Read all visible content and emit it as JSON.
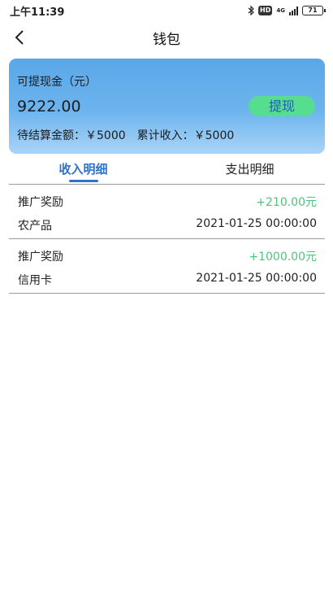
{
  "status_bar": {
    "time": "上午11:39",
    "hd": "HD",
    "network": "4G",
    "battery": "71"
  },
  "nav": {
    "title": "钱包"
  },
  "wallet": {
    "label": "可提现金（元）",
    "balance": "9222.00",
    "withdraw_label": "提现",
    "pending_label": "待结算金额：",
    "pending_value": "￥5000",
    "total_label": "累计收入：",
    "total_value": "￥5000"
  },
  "tabs": [
    {
      "label": "收入明细",
      "active": true
    },
    {
      "label": "支出明细",
      "active": false
    }
  ],
  "records": [
    {
      "type": "推广奖励",
      "amount": "+210.00元",
      "product": "农产品",
      "time": "2021-01-25 00:00:00"
    },
    {
      "type": "推广奖励",
      "amount": "+1000.00元",
      "product": "信用卡",
      "time": "2021-01-25 00:00:00"
    }
  ],
  "colors": {
    "accent": "#2f72c7",
    "income": "#4fc27b",
    "withdraw_button": "#56dd8f"
  }
}
